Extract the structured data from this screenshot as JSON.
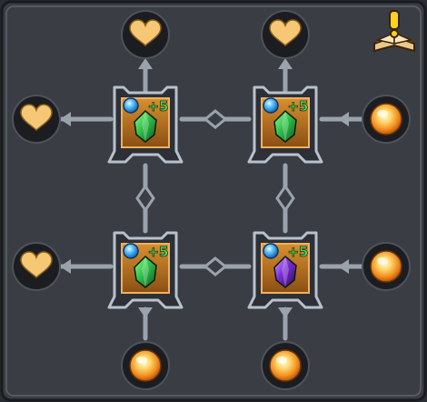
{
  "panel": {
    "colors": {
      "background": "#3a3d44",
      "frame": "#5e636b",
      "connector": "#9aa3ac",
      "node_fill": "#1c1d21",
      "heart": "#f6c875",
      "orb_outer": "#e0781a",
      "orb_inner": "#fff3c4",
      "socket_frame": "#b8c2cc",
      "socket_fill": "#c27a24",
      "gem_green": "#2fc24a",
      "gem_purple": "#7a2bd6",
      "badge_blue": "#3fa7e8",
      "plus_green": "#5fd65f"
    }
  },
  "help_button": {
    "icon": "book-exclamation-icon",
    "symbol": "!"
  },
  "sockets": [
    {
      "id": "top-left",
      "gem": "green-gem",
      "level": "+5"
    },
    {
      "id": "top-right",
      "gem": "green-gem",
      "level": "+5"
    },
    {
      "id": "bottom-left",
      "gem": "green-gem",
      "level": "+5"
    },
    {
      "id": "bottom-right",
      "gem": "purple-gem",
      "level": "+5"
    }
  ],
  "nodes": [
    {
      "id": "top-1",
      "icon": "heart-icon"
    },
    {
      "id": "top-2",
      "icon": "heart-icon"
    },
    {
      "id": "left-1",
      "icon": "heart-icon"
    },
    {
      "id": "left-2",
      "icon": "heart-icon"
    },
    {
      "id": "right-1",
      "icon": "orb-icon"
    },
    {
      "id": "right-2",
      "icon": "orb-icon"
    },
    {
      "id": "bottom-1",
      "icon": "orb-icon"
    },
    {
      "id": "bottom-2",
      "icon": "orb-icon"
    }
  ]
}
